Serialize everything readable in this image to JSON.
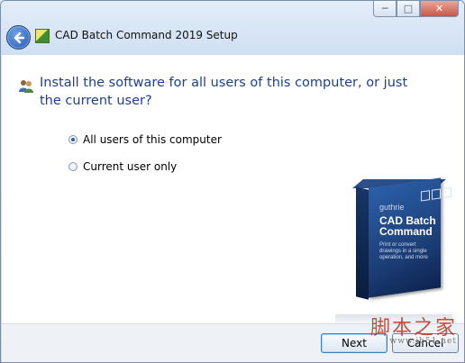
{
  "window": {
    "title": "CAD Batch Command 2019 Setup",
    "controls": {
      "minimize_icon": "minimize-icon",
      "maximize_icon": "maximize-icon",
      "close_icon": "close-icon"
    }
  },
  "content": {
    "question": "Install the software for all users of this computer, or just the current user?",
    "options": [
      {
        "label": "All users of this computer",
        "selected": true
      },
      {
        "label": "Current user only",
        "selected": false
      }
    ],
    "product_box": {
      "brand": "guthrie",
      "name_line1": "CAD Batch",
      "name_line2": "Command",
      "tagline": "Print or convert drawings in a single operation, and more"
    }
  },
  "footer": {
    "next_label": "Next",
    "cancel_label": "Cancel"
  },
  "watermark": {
    "text": "脚本之家",
    "url": "www.jb51.net"
  },
  "colors": {
    "accent_text": "#1e3f8a",
    "back_button": "#1c55b3",
    "close_button": "#c9574a"
  }
}
